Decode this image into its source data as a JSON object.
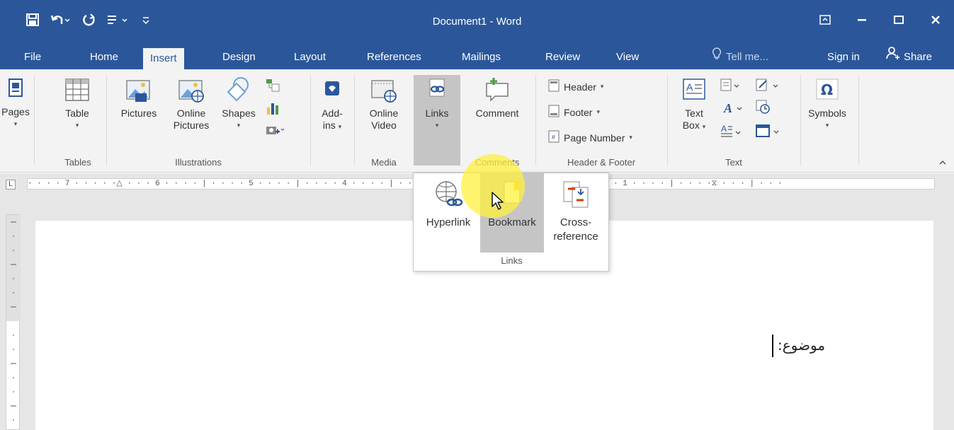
{
  "window": {
    "title": "Document1 - Word",
    "controls": [
      "ribbon-display-icon",
      "minimize-icon",
      "maximize-icon",
      "close-icon"
    ]
  },
  "quick_access": [
    "save-icon",
    "undo-icon",
    "redo-icon",
    "touch-mode-icon",
    "customize-qat-icon"
  ],
  "tabs": [
    {
      "label": "File"
    },
    {
      "label": "Home"
    },
    {
      "label": "Insert",
      "active": true
    },
    {
      "label": "Design"
    },
    {
      "label": "Layout"
    },
    {
      "label": "References"
    },
    {
      "label": "Mailings"
    },
    {
      "label": "Review"
    },
    {
      "label": "View"
    }
  ],
  "tellme": "Tell me...",
  "signin": "Sign in",
  "share": "Share",
  "ribbon": {
    "pages": "Pages",
    "table": "Table",
    "pictures": "Pictures",
    "online_pictures_1": "Online",
    "online_pictures_2": "Pictures",
    "shapes": "Shapes",
    "addins_1": "Add-",
    "addins_2": "ins",
    "online_video_1": "Online",
    "online_video_2": "Video",
    "links": "Links",
    "comment": "Comment",
    "header": "Header",
    "footer": "Footer",
    "page_number": "Page Number",
    "text_box_1": "Text",
    "text_box_2": "Box",
    "symbols": "Symbols",
    "groups": {
      "tables": "Tables",
      "illustrations": "Illustrations",
      "media": "Media",
      "comments": "Comments",
      "header_footer": "Header & Footer",
      "text": "Text"
    }
  },
  "ruler": {
    "content": "· · · · 7 · · · · ·△ · · · 6 · · · · | · · · · 5 · · · · | · · · · 4 · · · · | · · · · 3 · · · · | · · · · 2 · · · · | · · · · 1 · · · · | · · · ·⧖ · · · | · · ·"
  },
  "links_dropdown": {
    "hyperlink": "Hyperlink",
    "bookmark": "Bookmark",
    "cross_ref_1": "Cross-",
    "cross_ref_2": "reference",
    "group_label": "Links"
  },
  "document": {
    "text": "موضوع:"
  },
  "colors": {
    "accent": "#2b579a",
    "ribbon_bg": "#f3f3f3",
    "canvas_bg": "#e6e6e6",
    "highlight": "#fff03c"
  }
}
